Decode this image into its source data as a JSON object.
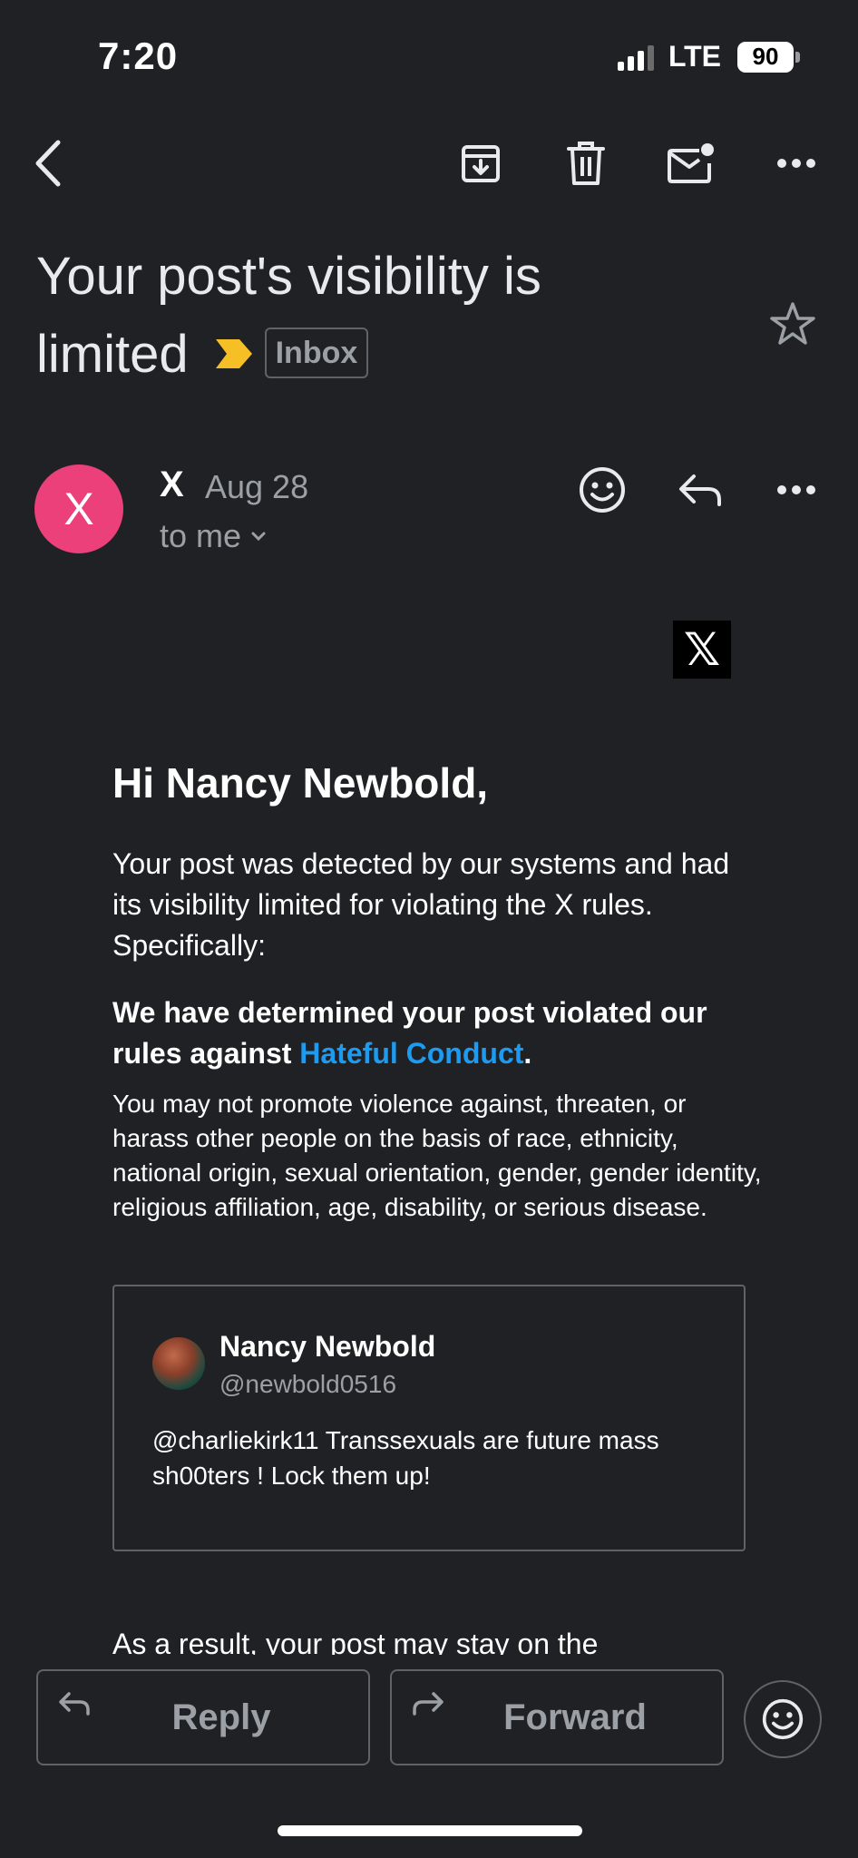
{
  "status": {
    "time": "7:20",
    "network": "LTE",
    "battery": "90"
  },
  "email": {
    "subject_line1": "Your post's visibility is",
    "subject_line2": "limited",
    "label": "Inbox",
    "sender": {
      "avatar_letter": "X",
      "name": "X",
      "date": "Aug 28",
      "recipient": "to me"
    }
  },
  "body": {
    "logo": "𝕏",
    "greeting": "Hi Nancy Newbold,",
    "paragraph1": "Your post was detected by our systems and had its visibility limited for violating the X rules. Specifically:",
    "paragraph2_prefix": "We have determined your post violated our rules against ",
    "paragraph2_link": "Hateful Conduct",
    "paragraph2_suffix": ".",
    "paragraph3": "You may not promote violence against, threaten, or harass other people on the basis of race, ethnicity, national origin, sexual orientation, gender, gender identity, religious affiliation, age, disability, or serious disease.",
    "tweet": {
      "name": "Nancy Newbold",
      "handle": "@newbold0516",
      "text": "@charliekirk11 Transsexuals are future mass sh00ters ! Lock them up!"
    },
    "paragraph4_partial": "As a result, your post may stay on the"
  },
  "actions": {
    "reply": "Reply",
    "forward": "Forward"
  },
  "colors": {
    "background": "#202124",
    "avatar": "#ec407a",
    "link": "#1d9bf0",
    "importance": "#f6bf26"
  }
}
